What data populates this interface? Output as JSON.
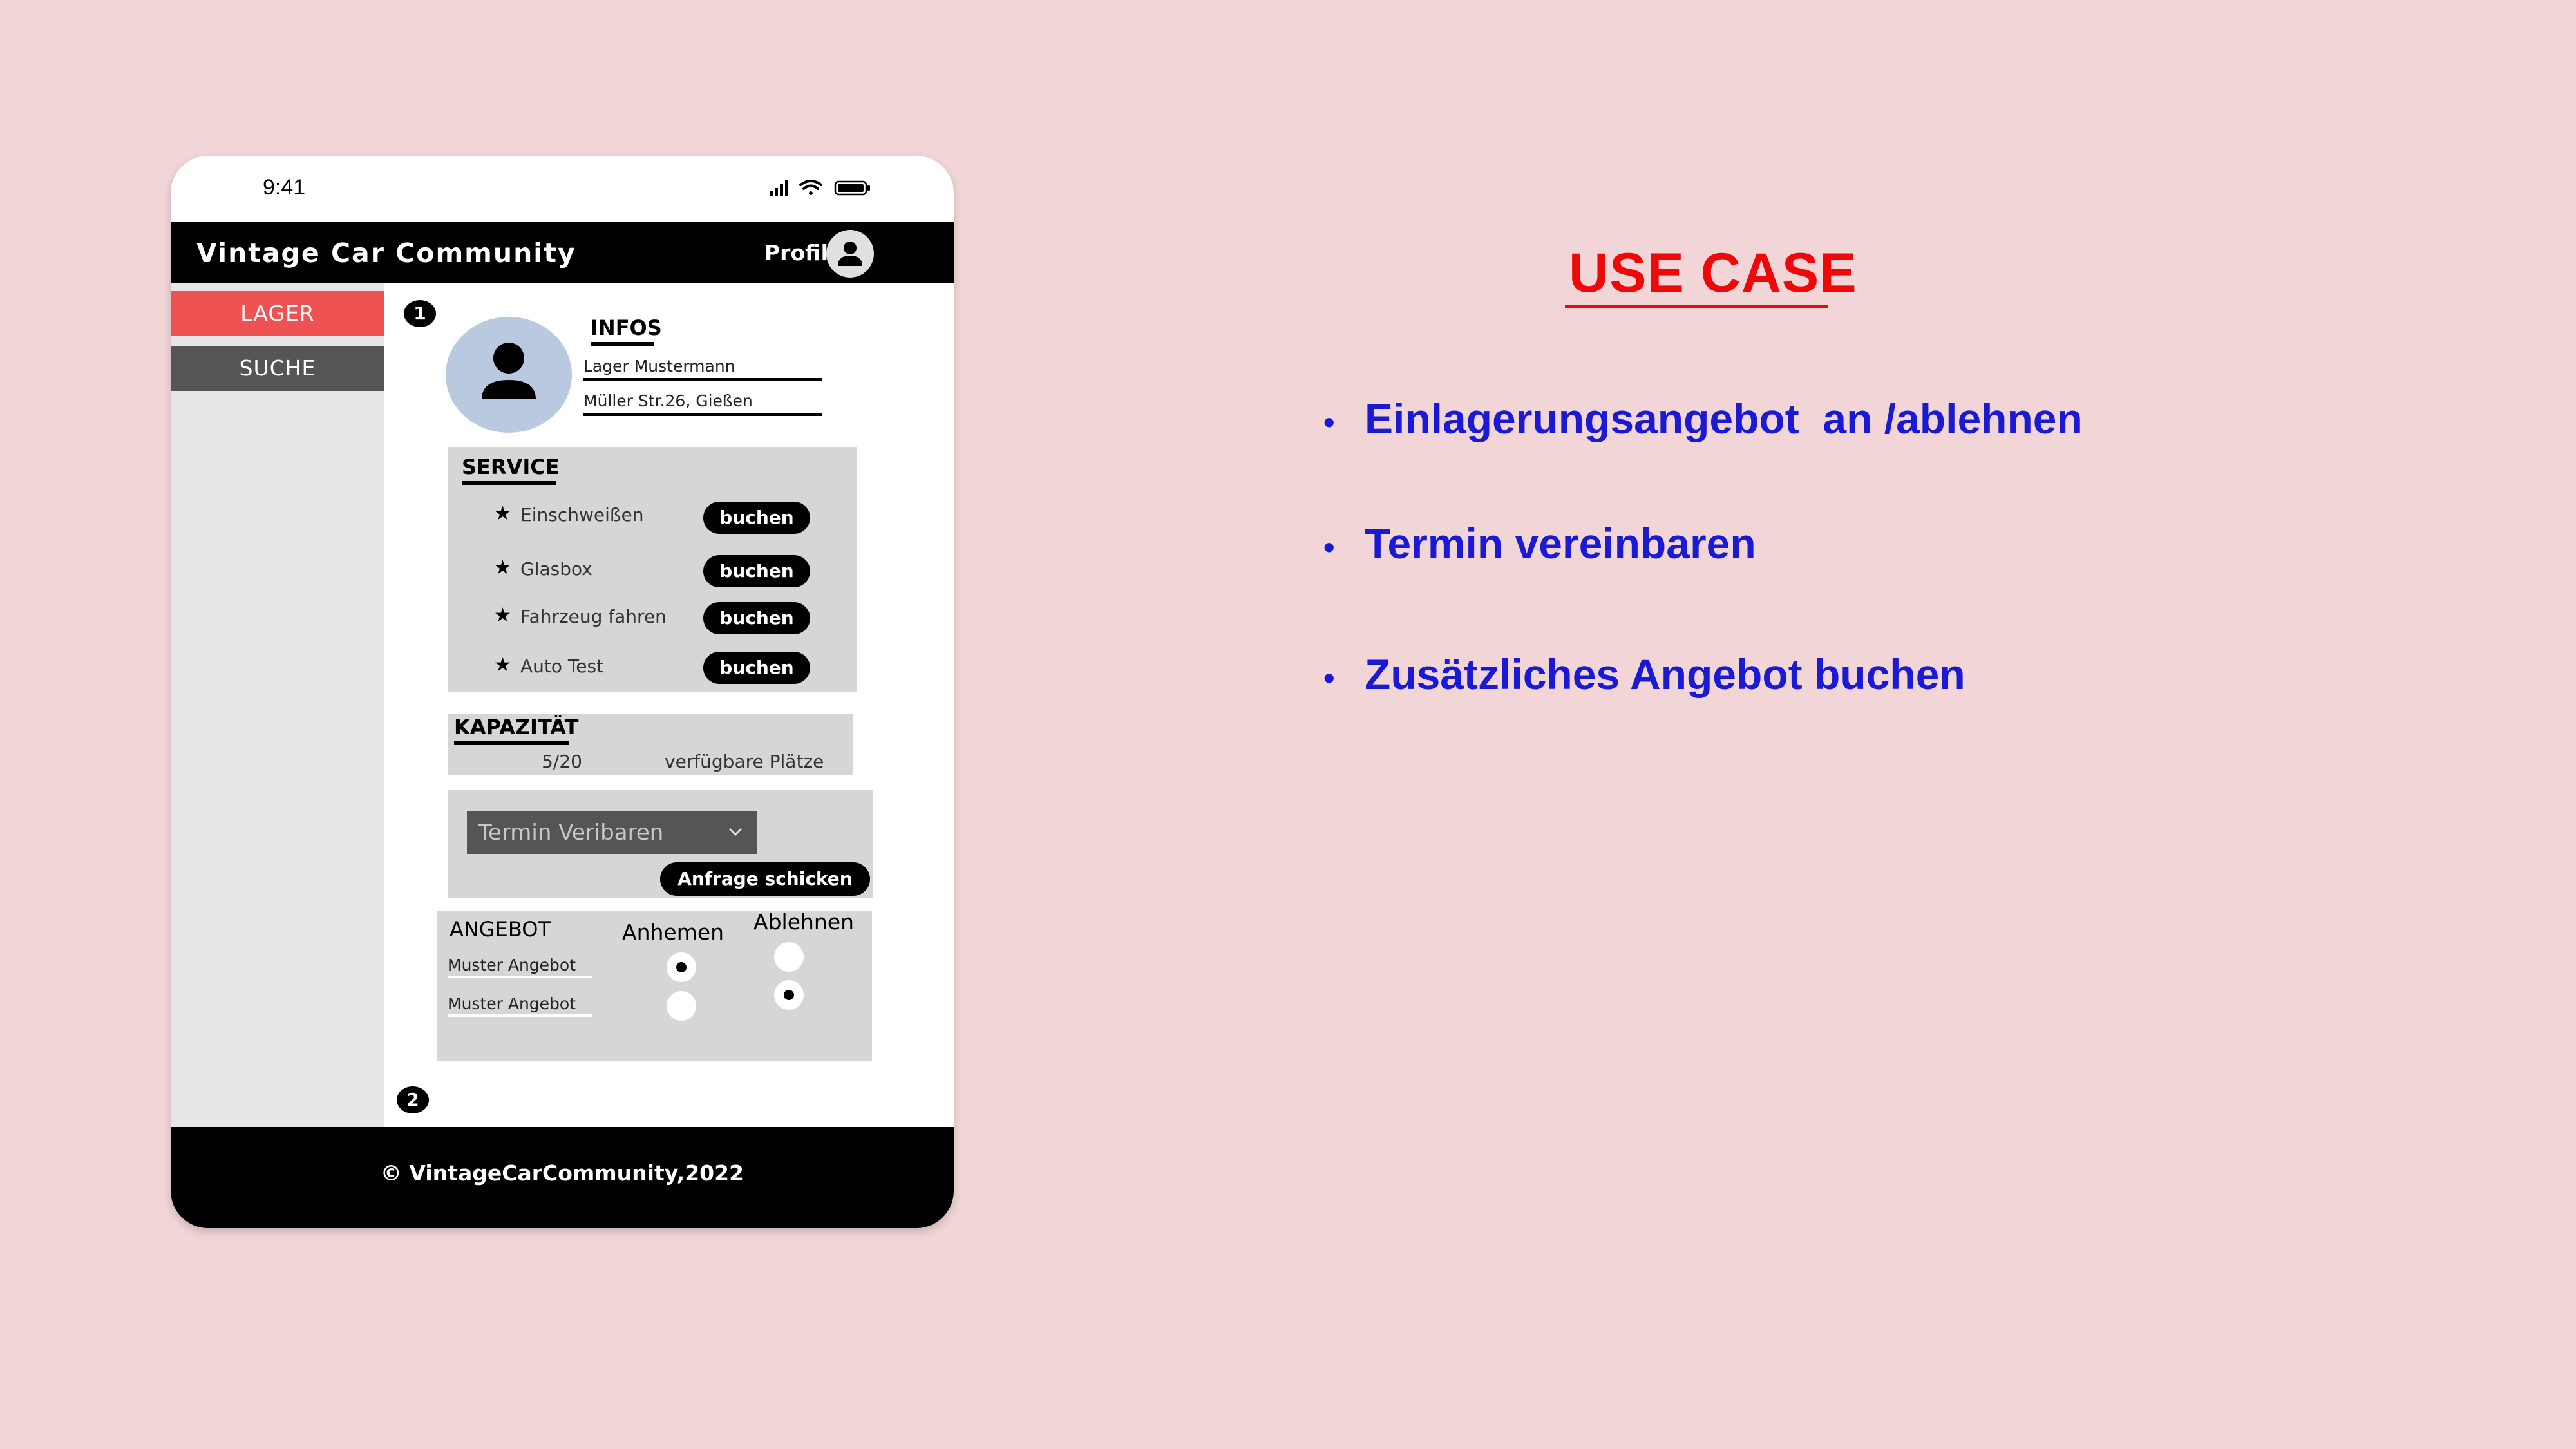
{
  "phone": {
    "status_time": "9:41",
    "app_title": "Vintage Car Community",
    "profile_label": "Profil",
    "sidebar": {
      "items": [
        {
          "label": "LAGER",
          "color": "#ef5253",
          "active": true
        },
        {
          "label": "SUCHE",
          "color": "#555555",
          "active": false
        }
      ]
    },
    "badges": [
      "1",
      "2"
    ],
    "infos": {
      "title": "INFOS",
      "name": "Lager Mustermann",
      "address": "Müller Str.26, Gießen"
    },
    "service": {
      "title": "SERVICE",
      "items": [
        {
          "label": "Einschweißen",
          "button": "buchen"
        },
        {
          "label": "Glasbox",
          "button": "buchen"
        },
        {
          "label": "Fahrzeug fahren",
          "button": "buchen"
        },
        {
          "label": "Auto Test",
          "button": "buchen"
        }
      ]
    },
    "capacity": {
      "title": "KAPAZITÄT",
      "value": "5/20",
      "label": "verfügbare Plätze"
    },
    "appointment": {
      "dropdown_value": "Termin Veribaren",
      "submit_label": "Anfrage schicken"
    },
    "offers": {
      "title": "ANGEBOT",
      "accept_label": "Anhemen",
      "reject_label": "Ablehnen",
      "rows": [
        {
          "label": "Muster Angebot",
          "selected": "accept"
        },
        {
          "label": "Muster Angebot",
          "selected": "reject"
        }
      ]
    },
    "footer": "© VintageCarCommunity,2022"
  },
  "use_case": {
    "title": "USE CASE",
    "items": [
      "Einlagerungsangebot  an /ablehnen",
      "Termin vereinbaren",
      "Zusätzliches Angebot buchen"
    ],
    "title_color": "#ee0808",
    "item_color": "#1a1ad4"
  },
  "icons": [
    "signal-icon",
    "wifi-icon",
    "battery-icon",
    "user-avatar-icon",
    "star-icon",
    "chevron-down-icon"
  ],
  "colors": {
    "background": "#f2d6d7",
    "panel": "#d6d6d6",
    "accent_red": "#ef5253"
  }
}
